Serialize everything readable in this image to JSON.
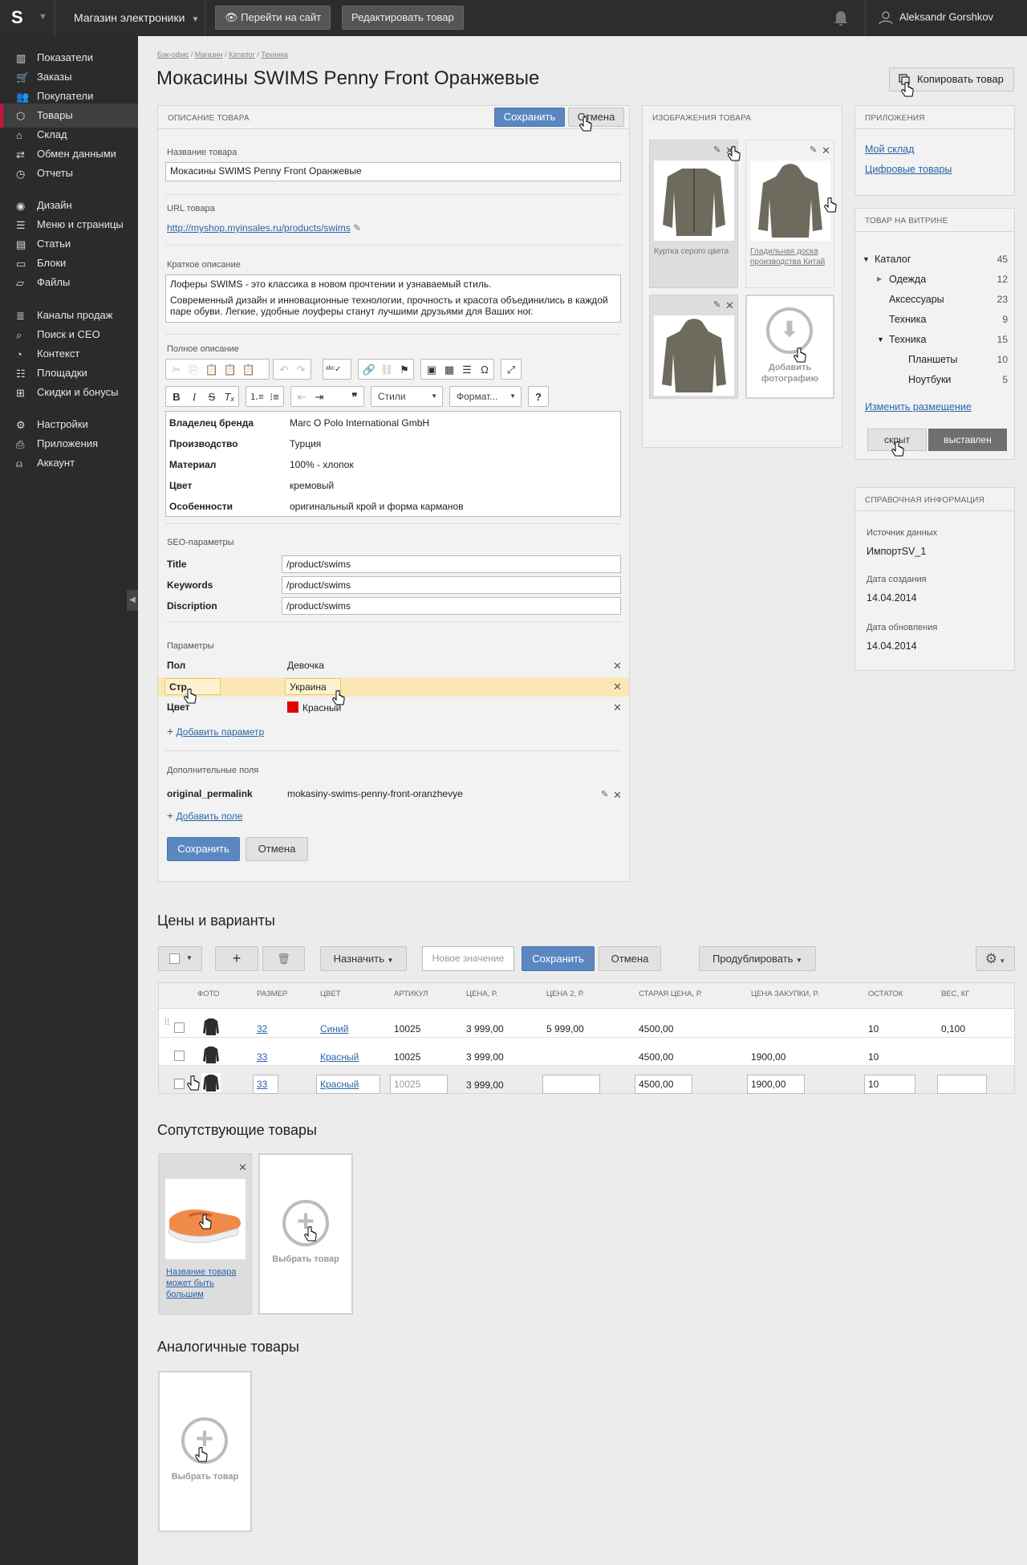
{
  "topbar": {
    "shop": "Магазин электроники",
    "go_site": "Перейти на сайт",
    "edit_product": "Редактировать товар",
    "user": "Aleksandr Gorshkov"
  },
  "sidebar": [
    {
      "label": "Показатели",
      "icon": "chart-icon"
    },
    {
      "label": "Заказы",
      "icon": "cart-icon"
    },
    {
      "label": "Покупатели",
      "icon": "users-icon"
    },
    {
      "label": "Товары",
      "icon": "box-icon",
      "active": true
    },
    {
      "label": "Склад",
      "icon": "warehouse-icon"
    },
    {
      "label": "Обмен данными",
      "icon": "exchange-icon"
    },
    {
      "label": "Отчеты",
      "icon": "clock-icon"
    },
    {
      "label": "Дизайн",
      "icon": "palette-icon"
    },
    {
      "label": "Меню и страницы",
      "icon": "menu-icon"
    },
    {
      "label": "Статьи",
      "icon": "article-icon"
    },
    {
      "label": "Блоки",
      "icon": "block-icon"
    },
    {
      "label": "Файлы",
      "icon": "folder-icon"
    },
    {
      "label": "Каналы продаж",
      "icon": "channels-icon"
    },
    {
      "label": "Поиск и СЕО",
      "icon": "search-icon"
    },
    {
      "label": "Контекст",
      "icon": "context-icon"
    },
    {
      "label": "Площадки",
      "icon": "list-icon"
    },
    {
      "label": "Скидки и бонусы",
      "icon": "gift-icon"
    },
    {
      "label": "Настройки",
      "icon": "gear-icon"
    },
    {
      "label": "Приложения",
      "icon": "apps-icon"
    },
    {
      "label": "Аккаунт",
      "icon": "user-icon"
    }
  ],
  "breadcrumbs": [
    "Бэк-офис",
    "Магазин",
    "Каталог",
    "Техника"
  ],
  "page_title": "Мокасины SWIMS Penny Front Оранжевые",
  "copy_button": "Копировать товар",
  "description": {
    "header": "Описание товара",
    "save": "Сохранить",
    "cancel": "Отмена",
    "name_label": "Название товара",
    "name_value": "Мокасины SWIMS Penny Front Оранжевые",
    "url_label": "URL товара",
    "url_value": "http://myshop.myinsales.ru/products/swims",
    "short_label": "Краткое описание",
    "short_p1": "Лоферы SWIMS - это классика в новом прочтении и узнаваемый стиль.",
    "short_p2": "Современный дизайн и инновационные технологии, прочность и красота объединились в каждой паре обуви. Легкие, удобные лоуферы станут лучшими друзьями для Ваших ног.",
    "full_label": "Полное описание",
    "styles": "Стили",
    "format": "Формат...",
    "full_table": [
      [
        "Владелец бренда",
        "Marc O Polo International GmbH"
      ],
      [
        "Производство",
        "Турция"
      ],
      [
        "Материал",
        "100% - хлопок"
      ],
      [
        "Цвет",
        "кремовый"
      ],
      [
        "Особенности",
        "оригинальный крой и форма карманов"
      ]
    ],
    "seo_label": "SEO-параметры",
    "seo": [
      [
        "Title",
        "/product/swims"
      ],
      [
        "Keywords",
        "/product/swims"
      ],
      [
        "Discription",
        "/product/swims"
      ]
    ],
    "params_label": "Параметры",
    "params": [
      [
        "Пол",
        "Девочка"
      ],
      [
        "Стр",
        "Украина"
      ],
      [
        "Цвет",
        "Красный"
      ]
    ],
    "add_param": "Добавить параметр",
    "extra_label": "Дополнительные поля",
    "extra_key": "original_permalink",
    "extra_value": "mokasiny-swims-penny-front-oranzhevye",
    "add_field": "Добавить поле"
  },
  "images": {
    "header": "Изображения товара",
    "cap1": "Куртка серого цвета",
    "cap2": "Гладильная доска производства Китай",
    "add": "Добавить фотографию"
  },
  "apps": {
    "header": "Приложения",
    "links": [
      "Мой склад",
      "Цифровые товары"
    ]
  },
  "showcase": {
    "header": "Товар на витрине",
    "tree": [
      [
        "Каталог",
        "45"
      ],
      [
        "Одежда",
        "12"
      ],
      [
        "Аксессуары",
        "23"
      ],
      [
        "Техника",
        "9"
      ],
      [
        "Техника",
        "15"
      ],
      [
        "Планшеты",
        "10"
      ],
      [
        "Ноутбуки",
        "5"
      ]
    ],
    "change": "Изменить размещение",
    "hidden": "скрыт",
    "shown": "выставлен"
  },
  "info": {
    "header": "Справочная информация",
    "src_label": "Источник данных",
    "src": "ИмпортSV_1",
    "created_label": "Дата создания",
    "created": "14.04.2014",
    "updated_label": "Дата обновления",
    "updated": "14.04.2014"
  },
  "prices": {
    "title": "Цены и варианты",
    "assign": "Назначить",
    "new_value": "Новое значение",
    "save": "Сохранить",
    "cancel": "Отмена",
    "duplicate": "Продублировать",
    "headers": [
      "Фото",
      "Размер",
      "Цвет",
      "Артикул",
      "Цена, р.",
      "Цена 2, р.",
      "Старая цена, р.",
      "Цена закупки, р.",
      "Остаток",
      "Вес, кг"
    ],
    "rows": [
      [
        "32",
        "Синий",
        "10025",
        "3 999,00",
        "5 999,00",
        "4500,00",
        "",
        "10",
        "0,100"
      ],
      [
        "33",
        "Красный",
        "10025",
        "3 999,00",
        "",
        "4500,00",
        "1900,00",
        "10",
        ""
      ],
      [
        "33",
        "Красный",
        "10025",
        "3 999,00",
        "",
        "4500,00",
        "1900,00",
        "10",
        ""
      ]
    ]
  },
  "related": {
    "title": "Сопутствующие товары",
    "caption": "Название товара может быть большим",
    "choose": "Выбрать товар"
  },
  "similar": {
    "title": "Аналогичные товары",
    "choose": "Выбрать товар"
  },
  "colors": {
    "accent": "#5b87c0",
    "active_marker": "#c8143c",
    "highlight": "#fbe7b5",
    "swatch_red": "#e00000"
  }
}
